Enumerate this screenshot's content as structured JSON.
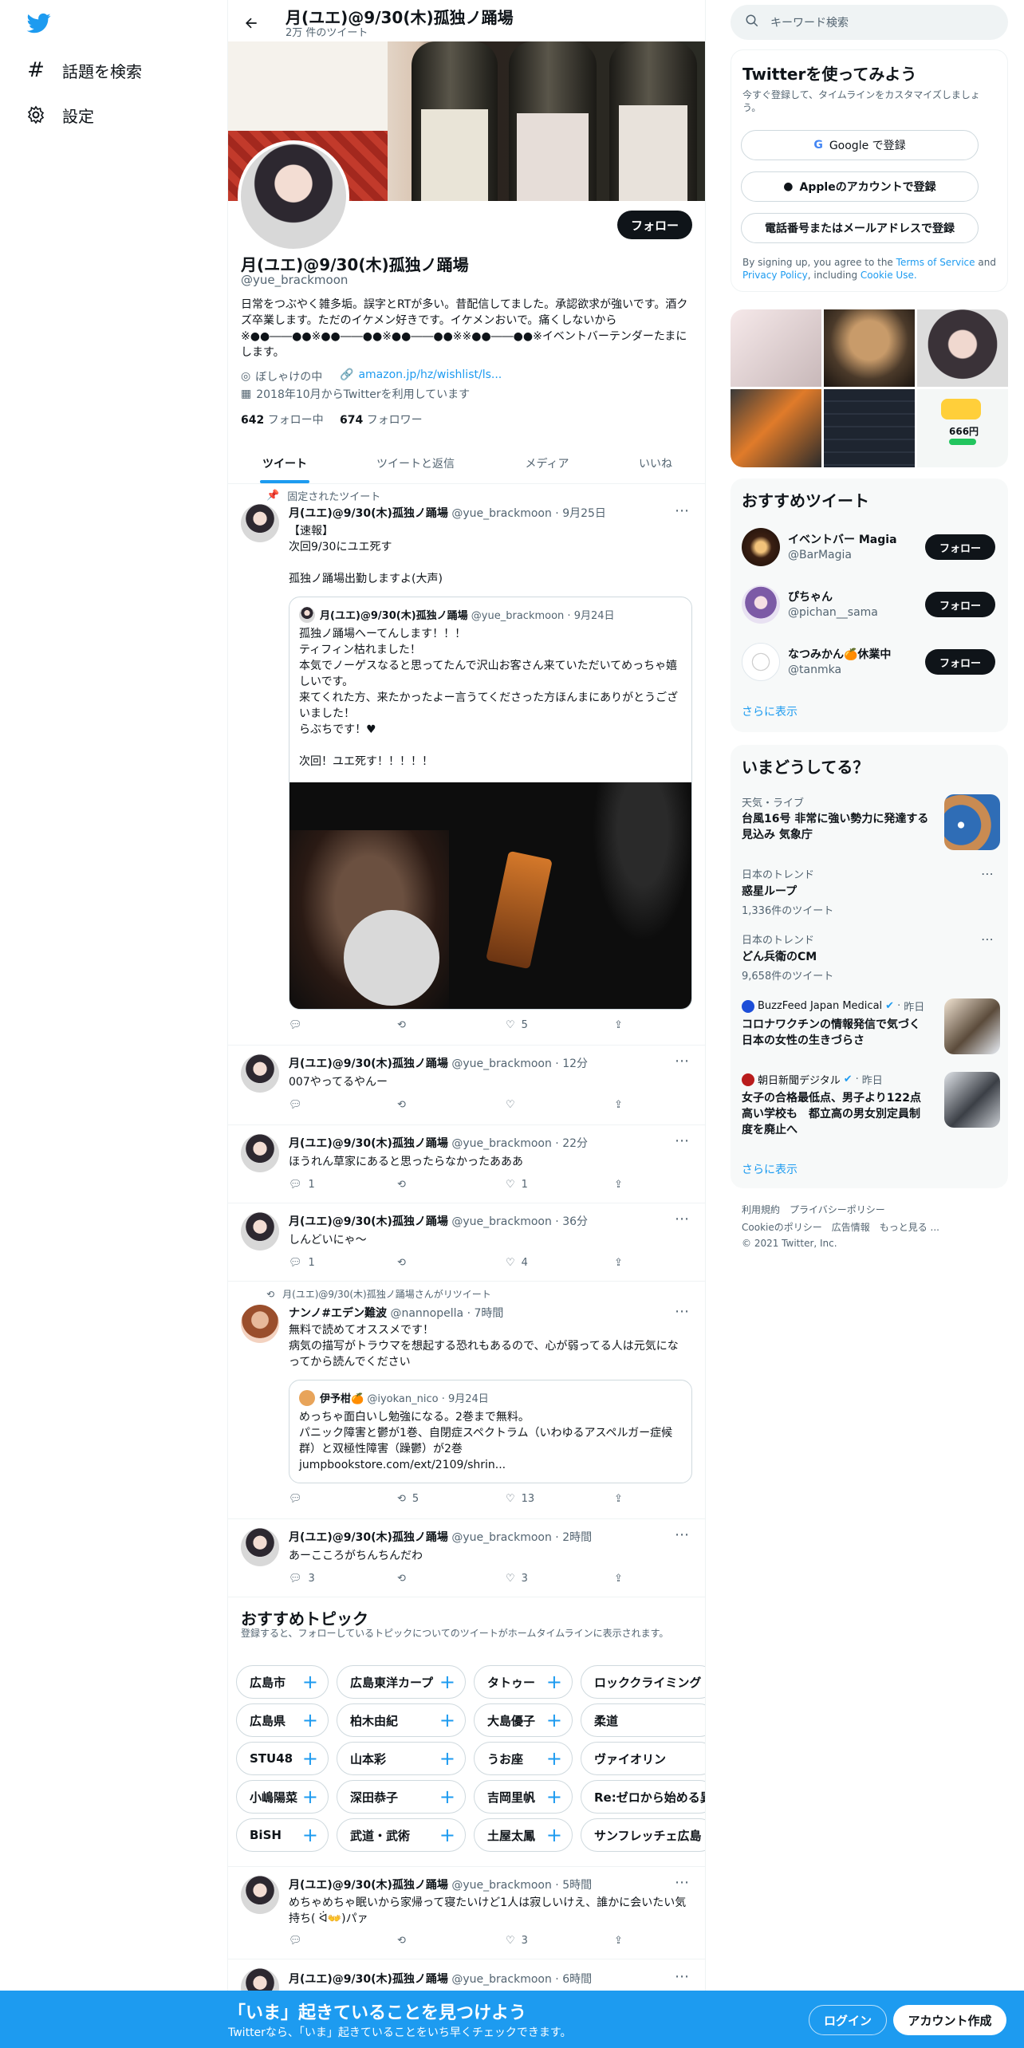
{
  "sidebar": {
    "items": [
      {
        "label": "話題を検索",
        "icon": "hashtag-icon"
      },
      {
        "label": "設定",
        "icon": "gear-icon"
      }
    ]
  },
  "profile": {
    "header_name": "月(ユエ)@9/30(木)孤独ノ踊場",
    "header_tweets": "2万 件のツイート",
    "name": "月(ユエ)@9/30(木)孤独ノ踊場",
    "handle": "@yue_brackmoon",
    "bio": "日常をつぶやく雑多垢。誤字とRTが多い。昔配信してました。承認欲求が強いです。酒クズ卒業します。ただのイケメン好きです。イケメンおいで。痛くしないから※●●――●●※●●――●●※●●――●●※※●●――●●※イベントバーテンダーたまにします。",
    "location": "ぼしゃけの中",
    "website": "amazon.jp/hz/wishlist/ls...",
    "joined": "2018年10月からTwitterを利用しています",
    "following_count": "642",
    "following_label": "フォロー中",
    "followers_count": "674",
    "followers_label": "フォロワー",
    "follow_button": "フォロー"
  },
  "tabs": [
    {
      "label": "ツイート",
      "active": true
    },
    {
      "label": "ツイートと返信",
      "active": false
    },
    {
      "label": "メディア",
      "active": false
    },
    {
      "label": "いいね",
      "active": false
    }
  ],
  "tweets": {
    "pinned_label": "固定されたツイート",
    "t1": {
      "name": "月(ユエ)@9/30(木)孤独ノ踊場",
      "handle": "@yue_brackmoon",
      "time": "9月25日",
      "text_1": "【速報】",
      "text_2": "次回9/30にユエ死す",
      "text_3": "孤独ノ踊場出勤しますよ(大声)",
      "likes": "5",
      "quote": {
        "name": "月(ユエ)@9/30(木)孤独ノ踊場",
        "handle": "@yue_brackmoon",
        "time": "9月24日",
        "line_1": "孤独ノ踊場へーてんします！！！",
        "line_2": "ティフィン枯れました！",
        "line_3": "本気でノーゲスなると思ってたんで沢山お客さん来ていただいてめっちゃ嬉しいです。",
        "line_4": "来てくれた方、来たかったよー言うてくださった方ほんまにありがとうございました！",
        "line_5": "らぶちです！♥",
        "line_6": "次回！ユエ死す！！！！！"
      }
    },
    "t2": {
      "name": "月(ユエ)@9/30(木)孤独ノ踊場",
      "handle": "@yue_brackmoon",
      "time": "12分",
      "text": "007やってるやんー"
    },
    "t3": {
      "name": "月(ユエ)@9/30(木)孤独ノ踊場",
      "handle": "@yue_brackmoon",
      "time": "22分",
      "text": "ほうれん草家にあると思ったらなかったあああ",
      "replies": "1",
      "likes": "1"
    },
    "t4": {
      "name": "月(ユエ)@9/30(木)孤独ノ踊場",
      "handle": "@yue_brackmoon",
      "time": "36分",
      "text": "しんどいにゃ〜",
      "replies": "1",
      "likes": "4"
    },
    "t5": {
      "retweet_label": "月(ユエ)@9/30(木)孤独ノ踊場さんがリツイート",
      "name": "ナンノ#エデン難波",
      "handle": "@nannopella",
      "time": "7時間",
      "text_1": "無料で読めてオススメです！",
      "text_2": "病気の描写がトラウマを想起する恐れもあるので、心が弱ってる人は元気になってから読んでください",
      "retweets": "5",
      "likes": "13",
      "quote": {
        "name": "伊予柑🍊",
        "handle": "@iyokan_nico",
        "time": "9月24日",
        "line_1": "めっちゃ面白いし勉強になる。2巻まで無料。",
        "line_2": "パニック障害と鬱が1巻、自閉症スペクトラム（いわゆるアスペルガー症候群）と双極性障害（躁鬱）が2巻",
        "line_3": "jumpbookstore.com/ext/2109/shrin..."
      }
    },
    "t6": {
      "name": "月(ユエ)@9/30(木)孤独ノ踊場",
      "handle": "@yue_brackmoon",
      "time": "2時間",
      "text": "あーこころがちんちんだわ",
      "replies": "3",
      "likes": "3"
    },
    "t7": {
      "name": "月(ユエ)@9/30(木)孤独ノ踊場",
      "handle": "@yue_brackmoon",
      "time": "5時間",
      "text": "めちゃめちゃ眠いから家帰って寝たいけど1人は寂しいけえ、誰かに会いたい気持ち( ᐛ👐)パァ",
      "likes": "3"
    },
    "t8": {
      "name": "月(ユエ)@9/30(木)孤独ノ踊場",
      "handle": "@yue_brackmoon",
      "time": "6時間"
    }
  },
  "topics": {
    "title": "おすすめトピック",
    "subtitle": "登録すると、フォローしているトピックについてのツイートがホームタイムラインに表示されます。",
    "rows": [
      [
        "広島市",
        "広島東洋カープ",
        "タトゥー",
        "ロッククライミング"
      ],
      [
        "広島県",
        "柏木由紀",
        "大島優子",
        "柔道"
      ],
      [
        "STU48",
        "山本彩",
        "うお座",
        "ヴァイオリン"
      ],
      [
        "小嶋陽菜",
        "深田恭子",
        "吉岡里帆",
        "Re:ゼロから始める異"
      ],
      [
        "BiSH",
        "武道・武術",
        "土屋太鳳",
        "サンフレッチェ広島"
      ]
    ]
  },
  "search": {
    "placeholder": "キーワード検索"
  },
  "signup": {
    "title": "Twitterを使ってみよう",
    "subtitle": "今すぐ登録して、タイムラインをカスタマイズしましょう。",
    "google": "Google で登録",
    "apple": "Appleのアカウントで登録",
    "phone": "電話番号またはメールアドレスで登録",
    "terms_1": "By signing up, you agree to the",
    "terms_link_1": "Terms of Service",
    "terms_2": "and",
    "terms_link_2": "Privacy Policy",
    "terms_3": ", including",
    "terms_link_3": "Cookie Use."
  },
  "media_grid": {
    "counter": "666円"
  },
  "recommended": {
    "title": "おすすめツイート",
    "users": [
      {
        "name": "イベントバー Magia",
        "handle": "@BarMagia",
        "button": "フォロー"
      },
      {
        "name": "ぴちゃん",
        "handle": "@pichan__sama",
        "button": "フォロー"
      },
      {
        "name": "なつみかん🍊休業中",
        "handle": "@tanmka",
        "button": "フォロー"
      }
    ],
    "more": "さらに表示"
  },
  "trends": {
    "title": "いまどうしてる？",
    "items": [
      {
        "category": "天気・ライブ",
        "title": "台風16号 非常に強い勢力に発達する見込み 気象庁"
      },
      {
        "category": "日本のトレンド",
        "title": "惑星ループ",
        "count": "1,336件のツイート"
      },
      {
        "category": "日本のトレンド",
        "title": "どん兵衛のCM",
        "count": "9,658件のツイート"
      },
      {
        "source": "BuzzFeed Japan Medical",
        "time": "昨日",
        "title": "コロナワクチンの情報発信で気づく日本の女性の生きづらさ"
      },
      {
        "source": "朝日新聞デジタル",
        "time": "昨日",
        "title": "女子の合格最低点、男子より122点高い学校も　都立高の男女別定員制度を廃止へ"
      }
    ],
    "more": "さらに表示"
  },
  "footer": {
    "links_1": "利用規約　プライバシーポリシー",
    "links_2": "Cookieのポリシー　広告情報　もっと見る ...",
    "copyright": "© 2021 Twitter, Inc."
  },
  "bottom_bar": {
    "title": "「いま」起きていることを見つけよう",
    "subtitle": "Twitterなら、「いま」起きていることをいち早くチェックできます。",
    "login": "ログイン",
    "signup": "アカウント作成"
  },
  "colors": {
    "twitter_blue": "#1d9bf0",
    "bottom_bar": "#1d9bf0"
  }
}
